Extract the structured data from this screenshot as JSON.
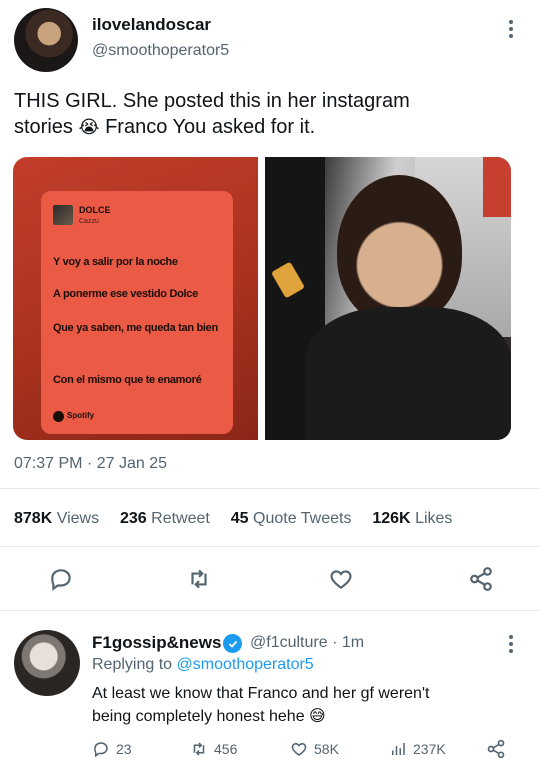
{
  "tweet": {
    "display_name": "ilovelandoscar",
    "handle": "@smoothoperator5",
    "text_line1": "THIS GIRL. She posted this in her instagram",
    "text_line2_pre": "stories",
    "text_line2_emoji": "😭",
    "text_line2_post": "Franco You asked for it.",
    "timestamp": "07:37 PM · 27 Jan 25",
    "stats": {
      "views_count": "878K",
      "views_label": "Views",
      "retweets_count": "236",
      "retweets_label": "Retweet",
      "quotes_count": "45",
      "quotes_label": "Quote Tweets",
      "likes_count": "126K",
      "likes_label": "Likes"
    }
  },
  "spotify_card": {
    "song_title": "DOLCE",
    "artist": "Cazzu",
    "lyrics": [
      "Y voy a salir por la noche",
      "A ponerme ese vestido Dolce",
      "Que ya saben, me queda tan bien",
      "Con el mismo que te enamoré"
    ],
    "brand": "Spotify"
  },
  "reply": {
    "display_name": "F1gossip&news",
    "handle": "@f1culture",
    "time": "· 1m",
    "replying_to_label": "Replying to",
    "replying_to_handle": "@smoothoperator5",
    "text_line1": "At least we know that Franco and her gf weren't",
    "text_line2": "being completely honest hehe",
    "text_emoji": "😅",
    "replies": "23",
    "retweets": "456",
    "likes": "58K",
    "views": "237K"
  },
  "colors": {
    "accent": "#1d9bf0",
    "card_red": "#e8533f",
    "card_dark": "#b7372a"
  }
}
